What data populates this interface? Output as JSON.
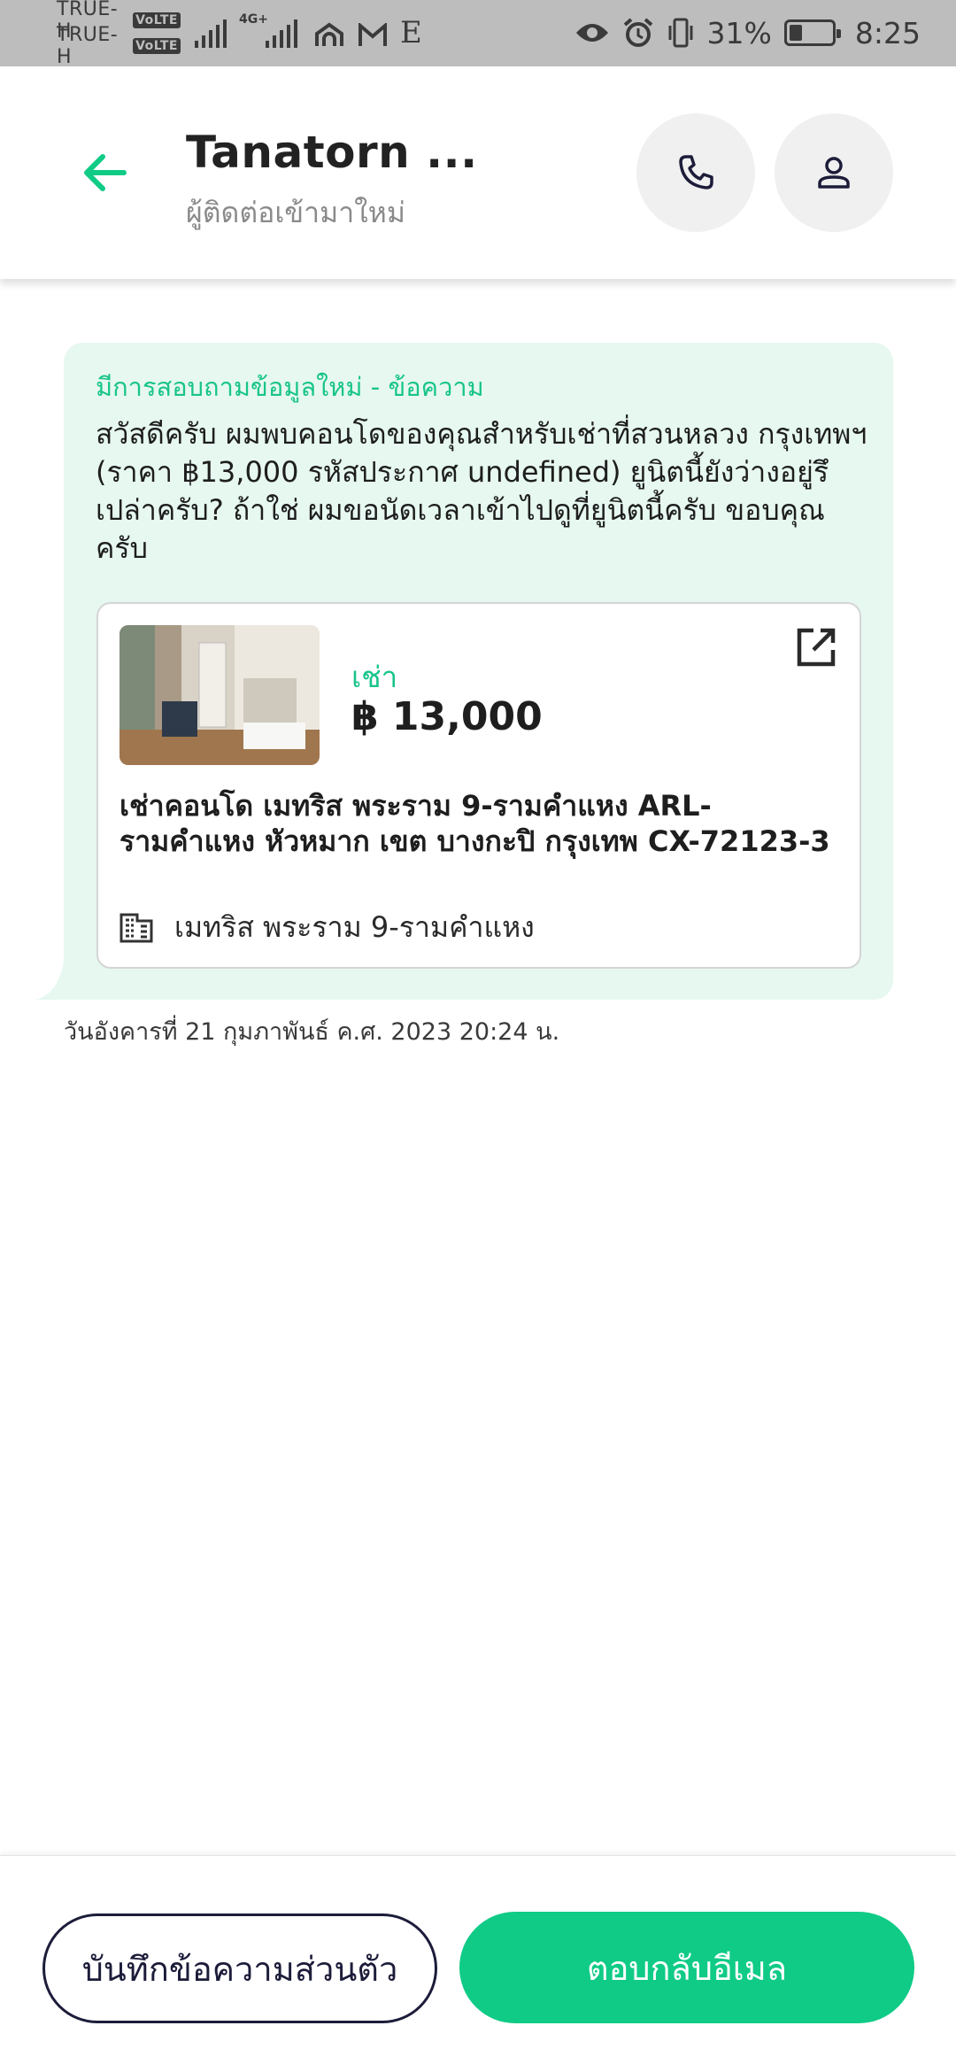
{
  "status_bar": {
    "carrier_1": "TRUE-H",
    "carrier_2": "TRUE-H",
    "volte_badge": "VoLTE",
    "network": "4G+",
    "edge_indicator": "E",
    "battery_text": "31%",
    "battery_level": 0.31,
    "time": "8:25",
    "icons": [
      "signal-icon",
      "wifi-icon",
      "gmail-icon",
      "eye-icon",
      "alarm-icon",
      "vibrate-icon",
      "battery-icon"
    ]
  },
  "header": {
    "title": "Tanatorn ...",
    "subtitle": "ผู้ติดต่อเข้ามาใหม่",
    "icons": [
      "back-arrow-icon",
      "phone-icon",
      "person-icon"
    ]
  },
  "message": {
    "label": "มีการสอบถามข้อมูลใหม่ - ข้อความ",
    "body": "สวัสดีครับ ผมพบคอนโดของคุณสำหรับเช่าที่สวนหลวง กรุงเทพฯ (ราคา ฿13,000 รหัสประกาศ undefined) ยูนิตนี้ยังว่างอยู่รึเปล่าครับ? ถ้าใช่ ผมขอนัดเวลาเข้าไปดูที่ยูนิตนี้ครับ ขอบคุณครับ",
    "timestamp": "วันอังคารที่ 21 กุมภาพันธ์ ค.ศ. 2023 20:24 น."
  },
  "listing": {
    "type_label": "เช่า",
    "price": "฿ 13,000",
    "title": "เช่าคอนโด  เมทริส พระราม 9-รามคำแหง ARL-รามคำแหง หัวหมาก เขต บางกะปิ กรุงเทพ CX-72123-3",
    "building": "เมทริส พระราม 9-รามคำแหง",
    "icons": [
      "open-external-icon",
      "building-icon"
    ]
  },
  "actions": {
    "note_label": "บันทึกข้อความส่วนตัว",
    "reply_label": "ตอบกลับอีเมล"
  },
  "colors": {
    "accent": "#0fcb86",
    "bubble": "#e6f8f0",
    "status_bar": "#bdbdbd"
  }
}
